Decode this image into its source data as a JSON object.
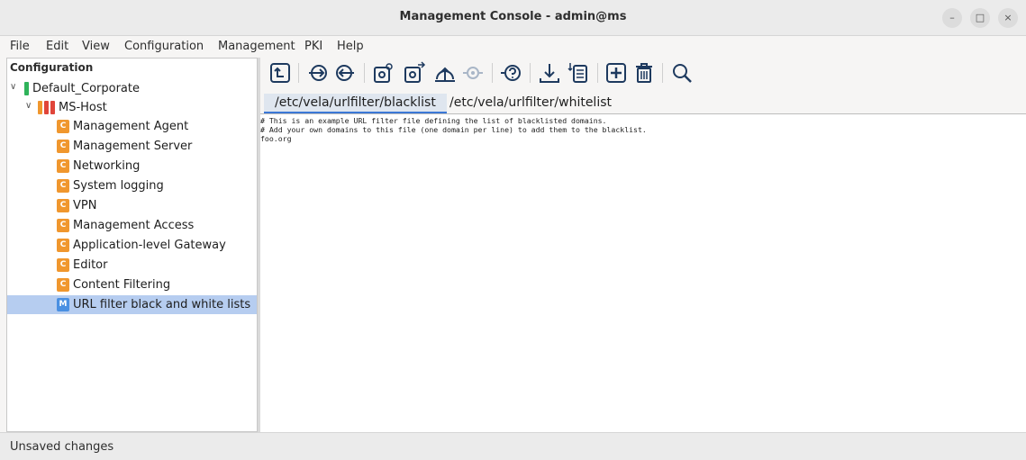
{
  "window": {
    "title": "Management Console - admin@ms",
    "controls": {
      "minimize": "–",
      "maximize": "□",
      "close": "×"
    }
  },
  "menu": [
    "File",
    "Edit",
    "View",
    "Configuration",
    "Management",
    "PKI",
    "Help"
  ],
  "sidebar": {
    "header": "Configuration",
    "tree": [
      {
        "label": "Default_Corporate",
        "level": 0,
        "expanded": true,
        "icon": "green-bar"
      },
      {
        "label": "MS-Host",
        "level": 1,
        "expanded": true,
        "icon": "host-bars"
      },
      {
        "label": "Management Agent",
        "level": 2,
        "badge": "C"
      },
      {
        "label": "Management Server",
        "level": 2,
        "badge": "C"
      },
      {
        "label": "Networking",
        "level": 2,
        "badge": "C"
      },
      {
        "label": "System logging",
        "level": 2,
        "badge": "C"
      },
      {
        "label": "VPN",
        "level": 2,
        "badge": "C"
      },
      {
        "label": "Management Access",
        "level": 2,
        "badge": "C"
      },
      {
        "label": "Application-level Gateway",
        "level": 2,
        "badge": "C"
      },
      {
        "label": "Editor",
        "level": 2,
        "badge": "C"
      },
      {
        "label": "Content Filtering",
        "level": 2,
        "badge": "C"
      },
      {
        "label": "URL filter black and white lists",
        "level": 2,
        "badge": "M",
        "selected": true
      }
    ]
  },
  "toolbar": {
    "icons": [
      "export-icon",
      "arrow-right-circle-icon",
      "arrow-left-circle-icon",
      "gear-view-icon",
      "gear-transfer-icon",
      "upload-cloud-icon",
      "gear-disabled-icon",
      "question-circle-icon",
      "download-icon",
      "list-sort-icon",
      "add-square-icon",
      "trash-icon",
      "search-icon"
    ]
  },
  "tabs": [
    "/etc/vela/urlfilter/blacklist",
    "/etc/vela/urlfilter/whitelist"
  ],
  "editor": {
    "lines": [
      "# This is an example URL filter file defining the list of blacklisted domains.",
      "# Add your own domains to this file (one domain per line) to add them to the blacklist.",
      "foo.org"
    ]
  },
  "status": "Unsaved changes",
  "colors": {
    "badge_c": "#f0972e",
    "badge_m": "#4a90e2",
    "selection": "#b6cdf0",
    "active_tab_underline": "#3b78d6",
    "green": "#2fb35a",
    "red": "#e0453a",
    "orange": "#f0972e"
  }
}
